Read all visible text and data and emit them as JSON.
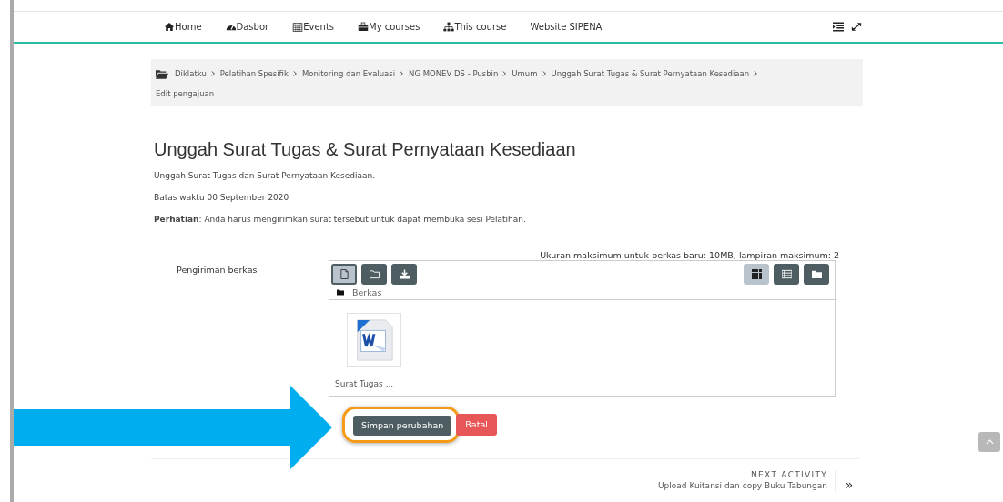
{
  "nav": {
    "items": [
      {
        "label": "Home"
      },
      {
        "label": "Dasbor"
      },
      {
        "label": "Events"
      },
      {
        "label": "My courses"
      },
      {
        "label": "This course"
      },
      {
        "label": "Website SIPENA"
      }
    ]
  },
  "breadcrumb": {
    "items": [
      "Diklatku",
      "Pelatihan Spesifik",
      "Monitoring dan Evaluasi",
      "NG MONEV DS - Pusbin",
      "Umum",
      "Unggah Surat Tugas & Surat Pernyataan Kesediaan",
      "Edit pengajuan"
    ]
  },
  "page": {
    "title": "Unggah Surat Tugas & Surat Pernyataan Kesediaan",
    "description": "Unggah Surat Tugas dan Surat Pernyataan Kesediaan.",
    "deadline": "Batas waktu 00 September 2020",
    "notice": "**Perhatian**: Anda harus mengirimkan surat tersebut untuk dapat membuka sesi Pelatihan."
  },
  "form": {
    "label": "Pengiriman berkas",
    "limits": "Ukuran maksimum untuk berkas baru: 10MB, lampiran maksimum: 2",
    "file_manager": {
      "actions": [
        {
          "selected": true
        },
        {
          "selected": false
        },
        {
          "selected": false
        }
      ],
      "views": [
        {
          "selected": true
        },
        {
          "selected": false
        },
        {
          "selected": false
        }
      ],
      "path": "Berkas",
      "files": [
        {
          "name": "Surat Tugas ..."
        }
      ]
    },
    "buttons": {
      "save": "Simpan perubahan",
      "cancel": "Batal"
    },
    "save_highlighted": true
  },
  "next_activity": {
    "label": "NEXT ACTIVITY",
    "title": "Upload Kuitansi dan copy Buku Tabungan",
    "chevron": "»"
  },
  "annotation_arrow": true
}
